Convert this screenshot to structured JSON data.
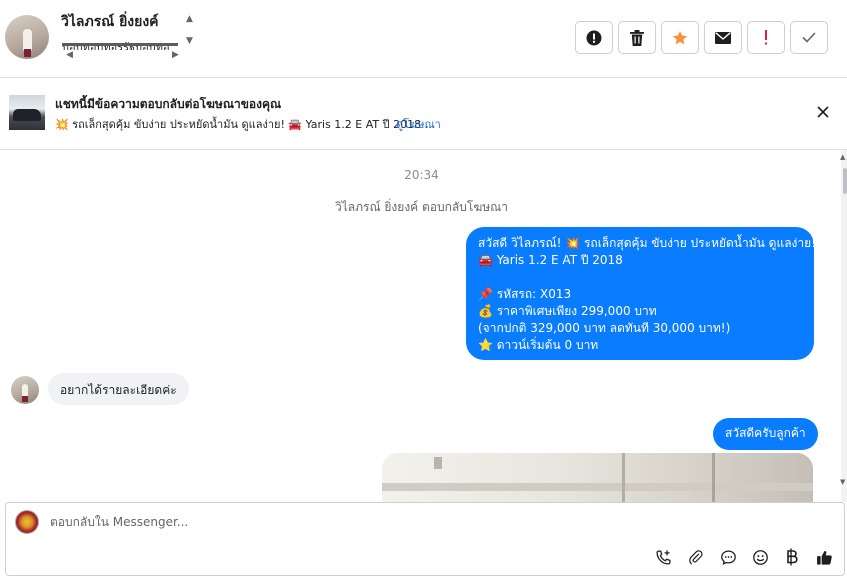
{
  "header": {
    "contact_name": "วิไลภรณ์ ยิ่งยงค์",
    "contact_sub": "บอบทอบทอรรัฐบอบทอ"
  },
  "header_actions": [
    {
      "name": "report-button",
      "icon": "exclamation-circle-icon"
    },
    {
      "name": "delete-button",
      "icon": "trash-icon"
    },
    {
      "name": "star-button",
      "icon": "star-icon",
      "color": "#f7923b"
    },
    {
      "name": "mark-unread-button",
      "icon": "envelope-icon"
    },
    {
      "name": "important-button",
      "icon": "exclamation-icon",
      "color": "#e41e3f"
    },
    {
      "name": "done-button",
      "icon": "check-icon"
    }
  ],
  "ad_banner": {
    "title": "แชทนี้มีข้อความตอบกลับต่อโฆษณาของคุณ",
    "description": "💥 รถเล็กสุดคุ้ม ขับง่าย ประหยัดน้ำมัน ดูแลง่าย! 🚘 Yaris 1.2 E AT ปี 2018 ...",
    "link_label": "ดูโฆษณา"
  },
  "conversation": {
    "timestamp": "20:34",
    "system_note": "วิไลภรณ์ ยิ่งยงค์ ตอบกลับโฆษณา",
    "ad_reply_lines": [
      "สวัสดี วิไลภรณ์! 💥 รถเล็กสุดคุ้ม ขับง่าย ประหยัดน้ำมัน ดูแลง่าย!",
      "🚘 Yaris 1.2 E AT ปี 2018",
      "",
      "📌 รหัสรถ: X013",
      "💰 ราคาพิเศษเพียง 299,000 บาท",
      "(จากปกติ 329,000 บาท  ลดทันที 30,000 บาท!)",
      "⭐ ดาวน์เริ่มต้น 0 บาท"
    ],
    "incoming_message": "อยากได้รายละเอียดค่ะ",
    "outgoing_greeting": "สวัสดีครับลูกค้า"
  },
  "composer": {
    "placeholder": "ตอบกลับใน Messenger...",
    "tools": [
      "phone-plus-icon",
      "paperclip-icon",
      "chat-bubble-icon",
      "emoji-icon",
      "baht-icon",
      "thumbs-up-icon"
    ]
  },
  "colors": {
    "outgoing_bubble": "#0a7cff",
    "incoming_bubble": "#f0f2f5",
    "link": "#216fdb"
  }
}
